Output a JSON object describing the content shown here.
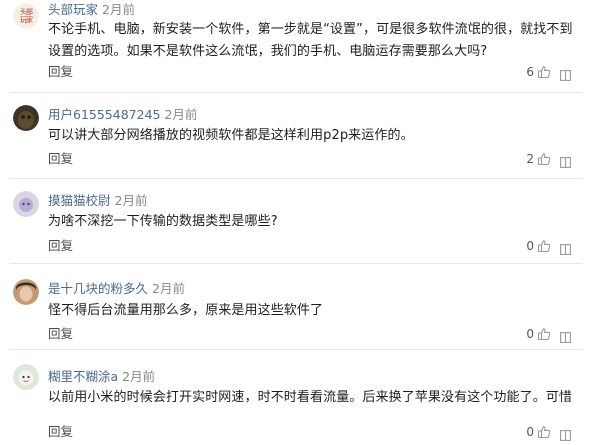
{
  "reply_label": "回复",
  "colors": {
    "username": "#4d6a8f",
    "time": "#8a8a8a",
    "divider": "#e8e8e8"
  },
  "comments": [
    {
      "username": "头部玩家",
      "time": "2月前",
      "text": "不论手机、电脑，新安装一个软件，第一步就是“设置”，可是很多软件流氓的很，就找不到设置的选项。如果不是软件这么流氓，我们的手机、电脑运存需要那么大吗?",
      "likes": "6"
    },
    {
      "username": "用户61555487245",
      "time": "2月前",
      "text": "可以讲大部分网络播放的视频软件都是这样利用p2p来运作的。",
      "likes": "2"
    },
    {
      "username": "摸猫猫校尉",
      "time": "2月前",
      "text": "为啥不深挖一下传输的数据类型是哪些?",
      "likes": "0"
    },
    {
      "username": "是十几块的粉多久",
      "time": "2月前",
      "text": "怪不得后台流量用那么多，原来是用这些软件了",
      "likes": "0"
    },
    {
      "username": "糊里不糊涂a",
      "time": "2月前",
      "text": "以前用小米的时候会打开实时网速，时不时看看流量。后来换了苹果没有这个功能了。可惜",
      "likes": "0"
    }
  ]
}
